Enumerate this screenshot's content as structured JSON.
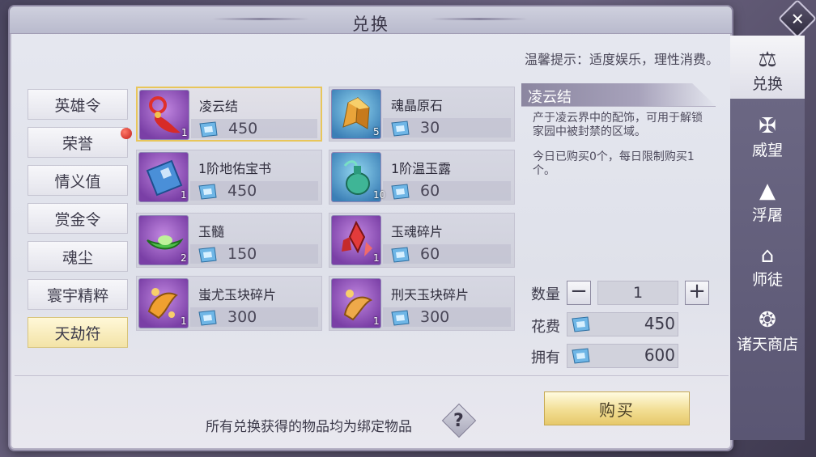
{
  "title": "兑换",
  "tip": "温馨提示：适度娱乐，理性消费。",
  "left_tabs": [
    {
      "label": "英雄令"
    },
    {
      "label": "荣誉"
    },
    {
      "label": "情义值"
    },
    {
      "label": "赏金令"
    },
    {
      "label": "魂尘"
    },
    {
      "label": "寰宇精粹"
    },
    {
      "label": "天劫符"
    }
  ],
  "items": [
    {
      "name": "凌云结",
      "price": "450",
      "count": "1",
      "icon": "knot-icon"
    },
    {
      "name": "魂晶原石",
      "price": "30",
      "count": "5",
      "icon": "crystal-ore-icon"
    },
    {
      "name": "1阶地佑宝书",
      "price": "450",
      "count": "1",
      "icon": "book-icon"
    },
    {
      "name": "1阶温玉露",
      "price": "60",
      "count": "10",
      "icon": "jade-bottle-icon"
    },
    {
      "name": "玉髓",
      "price": "150",
      "count": "2",
      "icon": "jade-leaf-icon"
    },
    {
      "name": "玉魂碎片",
      "price": "60",
      "count": "1",
      "icon": "red-shard-icon"
    },
    {
      "name": "蚩尤玉块碎片",
      "price": "300",
      "count": "1",
      "icon": "golden-fragment-icon"
    },
    {
      "name": "刑天玉块碎片",
      "price": "300",
      "count": "1",
      "icon": "golden-fragment-icon"
    }
  ],
  "detail": {
    "name": "凌云结",
    "desc": "产于凌云界中的配饰，可用于解锁家园中被封禁的区域。",
    "limit": "今日已购买0个，每日限制购买1个。",
    "qty_label": "数量",
    "qty": "1",
    "cost_label": "花费",
    "cost": "450",
    "own_label": "拥有",
    "own": "600",
    "minus": "−",
    "plus": "+"
  },
  "buy_label": "购买",
  "footer_note": "所有兑换获得的物品均为绑定物品",
  "help_label": "?",
  "close_label": "✕",
  "right_tabs": [
    {
      "label": "兑换",
      "icon": "scales-icon",
      "glyph": "⚖"
    },
    {
      "label": "威望",
      "icon": "wings-icon",
      "glyph": "✠"
    },
    {
      "label": "浮屠",
      "icon": "pagoda-icon",
      "glyph": "▲"
    },
    {
      "label": "师徒",
      "icon": "mentor-icon",
      "glyph": "⌂"
    },
    {
      "label": "诸天商店",
      "icon": "shop-emblem-icon",
      "glyph": "❂"
    }
  ],
  "colors": {
    "selected_border": "#e8c65a",
    "buy_gold": "#f2de93",
    "tab_active": "#fff8d8"
  }
}
